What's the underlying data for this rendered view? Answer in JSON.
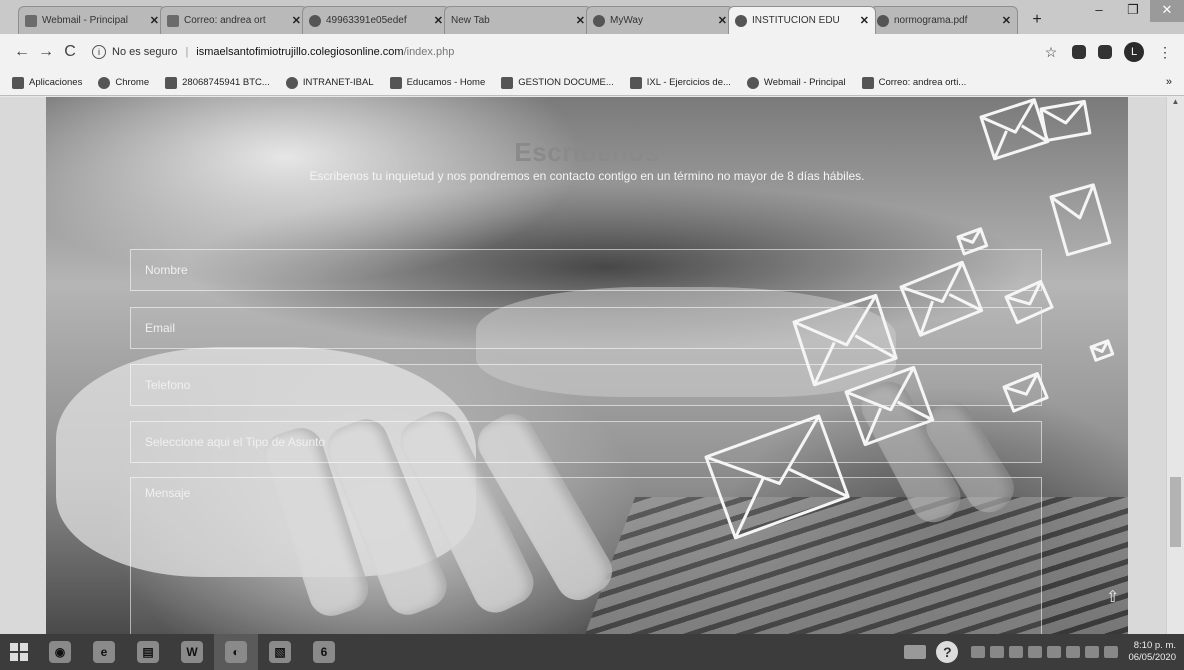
{
  "browser": {
    "tabs": [
      {
        "title": "Webmail - Principal",
        "active": false
      },
      {
        "title": "Correo: andrea ort",
        "active": false
      },
      {
        "title": "49963391e05edef",
        "active": false
      },
      {
        "title": "New Tab",
        "active": false
      },
      {
        "title": "MyWay",
        "active": false
      },
      {
        "title": "INSTITUCION EDU",
        "active": true
      },
      {
        "title": "normograma.pdf",
        "active": false
      }
    ],
    "new_tab": "+",
    "window": {
      "minimize": "–",
      "maximize": "❐",
      "close": "✕"
    },
    "nav": {
      "back": "←",
      "forward": "→",
      "reload": "C"
    },
    "address": {
      "security": "No es seguro",
      "host": "ismaelsantofimiotrujillo.colegiosonline.com",
      "path": "/index.php"
    },
    "toolbar_icons": {
      "star": "☆",
      "menu": "⋮",
      "avatar": "L"
    },
    "bookmarks": [
      {
        "label": "Aplicaciones"
      },
      {
        "label": "Chrome"
      },
      {
        "label": "28068745941 BTC..."
      },
      {
        "label": "INTRANET-IBAL"
      },
      {
        "label": "Educamos - Home"
      },
      {
        "label": "GESTION DOCUME..."
      },
      {
        "label": "IXL - Ejercicios de..."
      },
      {
        "label": "Webmail - Principal"
      },
      {
        "label": "Correo: andrea orti..."
      }
    ],
    "bookmarks_more": "»"
  },
  "page": {
    "heading": "Escribenos",
    "subheading": "Escribenos tu inquietud y nos pondremos en contacto contigo en un término no mayor de 8 días hábiles.",
    "form": {
      "name_placeholder": "Nombre",
      "email_placeholder": "Email",
      "phone_placeholder": "Telefono",
      "subject_placeholder": "Seleccione aqui el Tipo de Asunto",
      "message_placeholder": "Mensaje"
    },
    "scroll_top": "⇧"
  },
  "taskbar": {
    "apps": [
      {
        "glyph": "◉"
      },
      {
        "glyph": "e"
      },
      {
        "glyph": "▤"
      },
      {
        "glyph": "W"
      },
      {
        "glyph": "◐"
      },
      {
        "glyph": "▧"
      },
      {
        "glyph": "6"
      }
    ],
    "help": "?",
    "clock_time": "8:10 p. m.",
    "clock_date": "06/05/2020"
  }
}
